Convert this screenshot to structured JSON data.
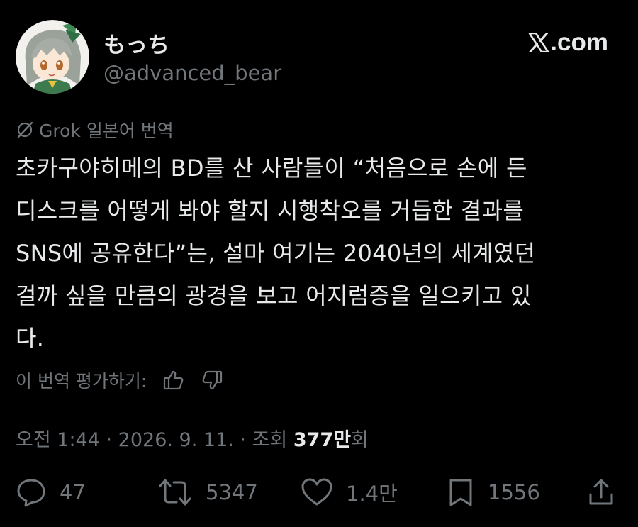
{
  "author": {
    "display_name": "もっち",
    "handle": "@advanced_bear",
    "avatar_icon": "avatar-anime-girl"
  },
  "brand": {
    "site_label": ".com",
    "logo_icon": "x-logo-icon"
  },
  "translation": {
    "label": "Grok 일본어 번역",
    "icon": "grok-icon"
  },
  "tweet": {
    "lines": [
      "초카구야히메의 BD를 산 사람들이 “처음으로 손에 든",
      "디스크를 어떻게 봐야 할지 시행착오를 거듭한 결과를",
      "SNS에 공유한다”는, 설마 여기는 2040년의 세계였던",
      "걸까 싶을 만큼의 광경을 보고 어지럼증을 일으키고 있",
      "다."
    ]
  },
  "rate_translation": {
    "label": "이 번역 평가하기:",
    "like_icon": "thumbs-up-icon",
    "dislike_icon": "thumbs-down-icon"
  },
  "meta": {
    "time": "오전 1:44",
    "separator": " · ",
    "date": "2026. 9. 11.",
    "views_label": "조회 ",
    "views_count": "377만",
    "views_suffix": "회"
  },
  "actions": {
    "replies": "47",
    "reposts": "5347",
    "likes": "1.4만",
    "bookmarks": "1556"
  },
  "colors": {
    "background": "#000000",
    "text": "#e7e9ea",
    "muted": "#71767b"
  }
}
